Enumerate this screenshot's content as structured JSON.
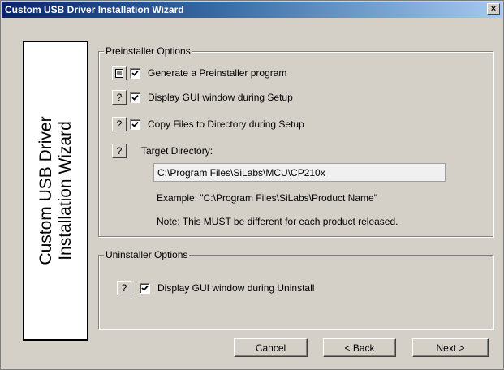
{
  "window": {
    "title": "Custom USB Driver Installation Wizard",
    "close_glyph": "×"
  },
  "side_panel": {
    "line1": "Custom USB Driver",
    "line2": "Installation Wizard"
  },
  "preinstaller": {
    "legend": "Preinstaller Options",
    "items": [
      {
        "label": "Generate a Preinstaller program",
        "checked": true,
        "help_icon": "document-icon"
      },
      {
        "label": "Display GUI window during Setup",
        "checked": true,
        "help_icon": "question-mark"
      },
      {
        "label": "Copy Files to Directory during Setup",
        "checked": true,
        "help_icon": "question-mark"
      }
    ],
    "help_glyph": "?",
    "target_label": "Target Directory:",
    "target_value": "C:\\Program Files\\SiLabs\\MCU\\CP210x",
    "example": "Example:  \"C:\\Program Files\\SiLabs\\Product Name\"",
    "note": "Note: This MUST be different for each product released."
  },
  "uninstaller": {
    "legend": "Uninstaller Options",
    "item": {
      "label": "Display GUI window during Uninstall",
      "checked": true
    }
  },
  "buttons": {
    "cancel": "Cancel",
    "back": "< Back",
    "next": "Next >"
  }
}
